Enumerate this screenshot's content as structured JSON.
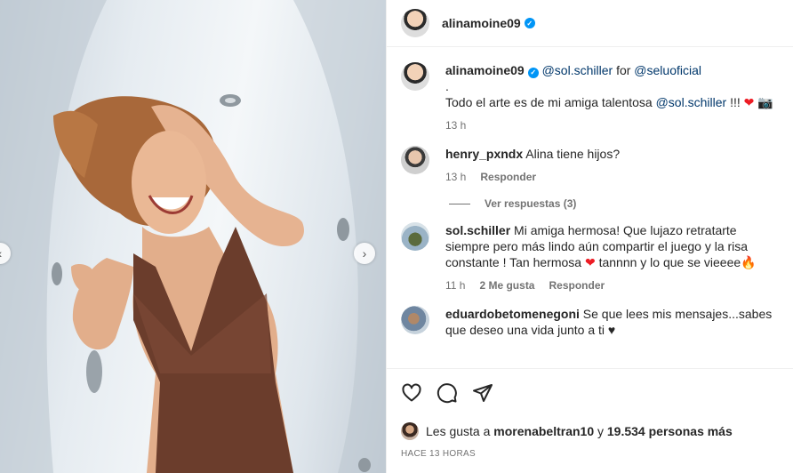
{
  "post": {
    "author": "alinamoine09",
    "verified_badge": "verified-check-icon"
  },
  "caption": {
    "author": "alinamoine09",
    "mention_1": "@sol.schiller",
    "for_word": "for",
    "mention_2": "@seluoficial",
    "dot": ".",
    "text_before": "Todo el arte es de mi amiga talentosa",
    "mention_3": "@sol.schiller",
    "text_after": "!!!",
    "emojis": "❤ 📷",
    "time": "13 h"
  },
  "comments": [
    {
      "user": "henry_pxndx",
      "text": "Alina tiene hijos?",
      "time": "13 h",
      "reply_label": "Responder"
    },
    {
      "user": "sol.schiller",
      "text": "Mi amiga hermosa! Que lujazo retratarte siempre pero más lindo aún compartir el juego y la risa constante ! Tan hermosa",
      "text_tail": "tannnn y lo que se vieeee🔥",
      "heart": "❤",
      "time": "11 h",
      "likes": "2 Me gusta",
      "reply_label": "Responder"
    },
    {
      "user": "eduardobetomenegoni",
      "text": "Se que lees mis mensajes...sabes que deseo una vida junto a ti ♥"
    }
  ],
  "view_replies": "Ver respuestas (3)",
  "likes": {
    "prefix": "Les gusta a",
    "first_user": "morenabeltran10",
    "connector": "y",
    "others": "19.534 personas más"
  },
  "posted_ago": "HACE 13 HORAS",
  "colors": {
    "link": "#00376b",
    "verified": "#0095f6",
    "heart": "#ed1c24",
    "muted": "#737373"
  }
}
